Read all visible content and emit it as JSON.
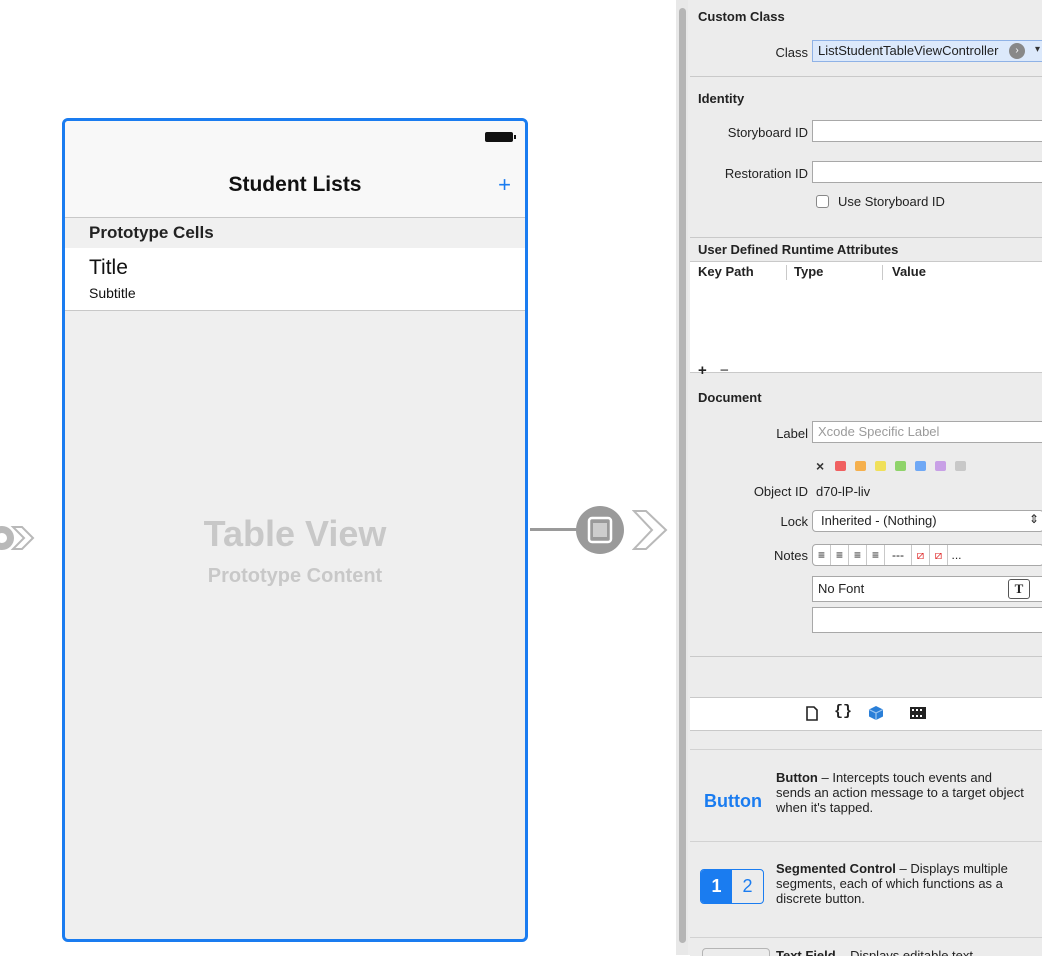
{
  "canvas": {
    "navigation_title": "Student Lists",
    "add_button": "+",
    "section_header": "Prototype Cells",
    "cell_title": "Title",
    "cell_subtitle": "Subtitle",
    "table_view_title": "Table View",
    "table_view_subtitle": "Prototype Content"
  },
  "custom_class": {
    "section_title": "Custom Class",
    "class_label": "Class",
    "class_value": "ListStudentTableViewController"
  },
  "identity": {
    "section_title": "Identity",
    "storyboard_id_label": "Storyboard ID",
    "storyboard_id_value": "",
    "restoration_id_label": "Restoration ID",
    "restoration_id_value": "",
    "use_storyboard_id_label": "Use Storyboard ID"
  },
  "runtime_attributes": {
    "section_title": "User Defined Runtime Attributes",
    "columns": [
      "Key Path",
      "Type",
      "Value"
    ],
    "add": "+",
    "remove": "−"
  },
  "document": {
    "section_title": "Document",
    "label_label": "Label",
    "label_placeholder": "Xcode Specific Label",
    "color_clear": "×",
    "label_colors": [
      "#f06060",
      "#f5b04d",
      "#f0e05a",
      "#8fd36a",
      "#6fa8f5",
      "#c8a0e6",
      "#c8c8c8"
    ],
    "object_id_label": "Object ID",
    "object_id_value": "d70-lP-liv",
    "lock_label": "Lock",
    "lock_value": "Inherited - (Nothing)",
    "notes_label": "Notes",
    "notes_buttons": [
      "≡",
      "≡",
      "≡",
      "≡",
      "---",
      "⧄",
      "⧄",
      "..."
    ],
    "font_value": "No Font",
    "font_button": "T"
  },
  "library_tabs": [
    "file-icon",
    "braces-icon",
    "object-icon",
    "media-icon"
  ],
  "library": [
    {
      "badge": "Button",
      "name": "Button",
      "desc": " – Intercepts touch events and sends an action message to a target object when it's tapped."
    },
    {
      "badge1": "1",
      "badge2": "2",
      "name": "Segmented Control",
      "desc": " – Displays multiple segments, each of which functions as a discrete button."
    },
    {
      "name": "Text Field",
      "desc": " – Displays editable text."
    }
  ]
}
